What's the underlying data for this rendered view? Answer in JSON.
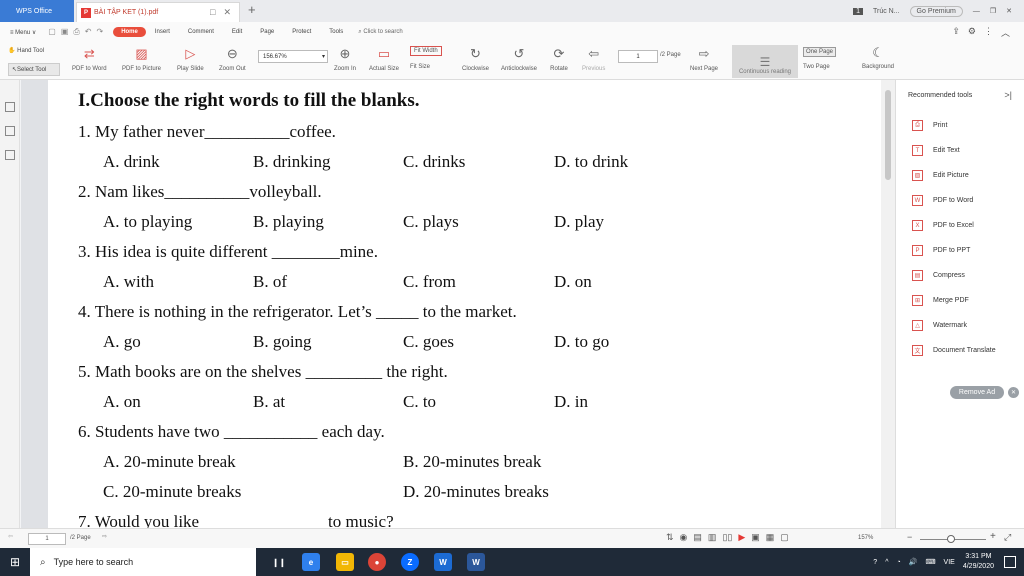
{
  "titlebar": {
    "app_tab": "WPS Office",
    "doc_tab": "BÀI TẬP KET (1).pdf",
    "new_tab": "+",
    "user_badge": "1",
    "user_name": "Trúc N...",
    "premium": "Go Premium"
  },
  "menubar": {
    "menu": "Menu",
    "items": [
      "Home",
      "Insert",
      "Comment",
      "Edit",
      "Page",
      "Protect",
      "Tools"
    ],
    "search": "Click to search"
  },
  "toolbar": {
    "hand_tool": "Hand Tool",
    "select_tool": "Select Tool",
    "pdf_to_word": "PDF to Word",
    "pdf_to_picture": "PDF to Picture",
    "play_slide": "Play Slide",
    "zoom_out": "Zoom Out",
    "zoom_value": "156.67%",
    "zoom_in": "Zoom In",
    "actual_size": "Actual Size",
    "fit_width": "Fit Width",
    "fit_size": "Fit Size",
    "clockwise": "Clockwise",
    "anticlockwise": "Anticlockwise",
    "rotate": "Rotate",
    "previous": "Previous",
    "page_value": "1",
    "page_total": "/2 Page",
    "next_page": "Next Page",
    "continuous_reading": "Continuous reading",
    "one_page": "One Page",
    "two_page": "Two Page",
    "background": "Background"
  },
  "document": {
    "heading": "I.Choose the right words to fill the blanks.",
    "questions": [
      {
        "text": "1.  My father never__________coffee.",
        "options": [
          "A. drink",
          "B. drinking",
          "C. drinks",
          "D. to drink"
        ]
      },
      {
        "text": "2.  Nam likes__________volleyball.",
        "options": [
          "A. to playing",
          "B. playing",
          "C. plays",
          "D. play"
        ]
      },
      {
        "text": "3.  His idea is quite different ________mine.",
        "options": [
          "A. with",
          "B. of",
          "C. from",
          "D. on"
        ]
      },
      {
        "text": "4.  There is nothing in the refrigerator. Let’s _____ to the market.",
        "options": [
          "A. go",
          "B. going",
          "C. goes",
          "D. to go"
        ]
      },
      {
        "text": "5.  Math books are on the shelves _________ the right.",
        "options": [
          "A. on",
          "B. at",
          "C. to",
          "D. in"
        ]
      },
      {
        "text": "6.  Students have two     ___________ each day.",
        "options": [
          "A. 20-minute break",
          "B. 20-minutes break",
          "C. 20-minute breaks",
          "D. 20-minutes breaks"
        ]
      },
      {
        "text": "7.  Would you like",
        "text_end": "to music?"
      }
    ]
  },
  "right_panel": {
    "title": "Recommended tools",
    "items": [
      "Print",
      "Edit Text",
      "Edit Picture",
      "PDF to Word",
      "PDF to Excel",
      "PDF to PPT",
      "Compress",
      "Merge PDF",
      "Watermark",
      "Document Translate"
    ],
    "remove_ad": "Remove Ad"
  },
  "statusbar": {
    "page_value": "1",
    "page_total": "/2 Page",
    "zoom": "157%"
  },
  "taskbar": {
    "search_placeholder": "Type here to search",
    "language": "VIE",
    "time": "3:31 PM",
    "date": "4/29/2020"
  }
}
